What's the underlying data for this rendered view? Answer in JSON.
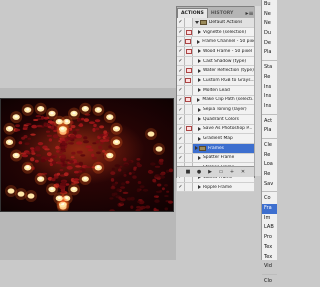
{
  "panel": {
    "tabs": [
      {
        "label": "ACTIONS"
      },
      {
        "label": "HISTORY"
      }
    ],
    "menu_button": "▸≡"
  },
  "actions": [
    {
      "label": "Default Actions",
      "type": "set",
      "expanded": true,
      "checked": true,
      "dialog": false
    },
    {
      "label": "Vignette (selection)",
      "checked": true,
      "dialog": true
    },
    {
      "label": "Frame Channel - 50 pixel",
      "checked": true,
      "dialog": true
    },
    {
      "label": "Wood Frame - 50 pixel",
      "checked": true,
      "dialog": true
    },
    {
      "label": "Cast Shadow (type)",
      "checked": true,
      "dialog": false
    },
    {
      "label": "Water Reflection (type)",
      "checked": true,
      "dialog": true
    },
    {
      "label": "Custom RGB to Grays...",
      "checked": true,
      "dialog": true
    },
    {
      "label": "Molten Lead",
      "checked": true,
      "dialog": false
    },
    {
      "label": "Make Clip Path (selecti...",
      "checked": true,
      "dialog": true
    },
    {
      "label": "Sepia Toning (layer)",
      "checked": true,
      "dialog": false
    },
    {
      "label": "Quadrant Colors",
      "checked": true,
      "dialog": false
    },
    {
      "label": "Save As Photoshop P...",
      "checked": true,
      "dialog": true
    },
    {
      "label": "Gradient Map",
      "checked": true,
      "dialog": false
    },
    {
      "label": "Frames",
      "type": "set",
      "expanded": false,
      "checked": true,
      "dialog": false,
      "selected": true
    },
    {
      "label": "Spatter Frame",
      "checked": true,
      "dialog": false
    },
    {
      "label": "Strokes Frame",
      "checked": true,
      "dialog": false
    },
    {
      "label": "Waves Frame",
      "checked": true,
      "dialog": false
    },
    {
      "label": "Ripple Frame",
      "checked": true,
      "dialog": false
    }
  ],
  "footer_buttons": [
    {
      "icon": "stop-icon",
      "glyph": "■"
    },
    {
      "icon": "record-icon",
      "glyph": "●"
    },
    {
      "icon": "play-icon",
      "glyph": "▶"
    },
    {
      "icon": "new-set-icon",
      "glyph": "▭"
    },
    {
      "icon": "new-action-icon",
      "glyph": "+"
    },
    {
      "icon": "delete-icon",
      "glyph": "✕"
    }
  ],
  "menu": {
    "items": [
      {
        "label": "Bu"
      },
      {
        "label": "Ne"
      },
      {
        "label": "Ne"
      },
      {
        "label": "Du"
      },
      {
        "label": "De"
      },
      {
        "label": "Pla"
      },
      {
        "sep": true
      },
      {
        "label": "Sta"
      },
      {
        "label": "Re"
      },
      {
        "label": "Ins"
      },
      {
        "label": "Ins"
      },
      {
        "label": "Ins"
      },
      {
        "sep": true
      },
      {
        "label": "Act"
      },
      {
        "label": "Pla"
      },
      {
        "sep": true
      },
      {
        "label": "Cle"
      },
      {
        "label": "Re"
      },
      {
        "label": "Loa"
      },
      {
        "label": "Re"
      },
      {
        "label": "Sav"
      },
      {
        "sep": true
      },
      {
        "label": "Co"
      },
      {
        "label": "Fra",
        "highlight": true
      },
      {
        "label": "Im"
      },
      {
        "label": "LAB"
      },
      {
        "label": "Pro"
      },
      {
        "label": "Tex"
      },
      {
        "label": "Tex"
      },
      {
        "label": "Vid"
      },
      {
        "sep": true
      },
      {
        "label": "Clo"
      }
    ]
  },
  "colors": {
    "selection": "#3d6fcf",
    "panel_bg": "#e8e8e8",
    "candle_flame": "#ffe7a8"
  }
}
